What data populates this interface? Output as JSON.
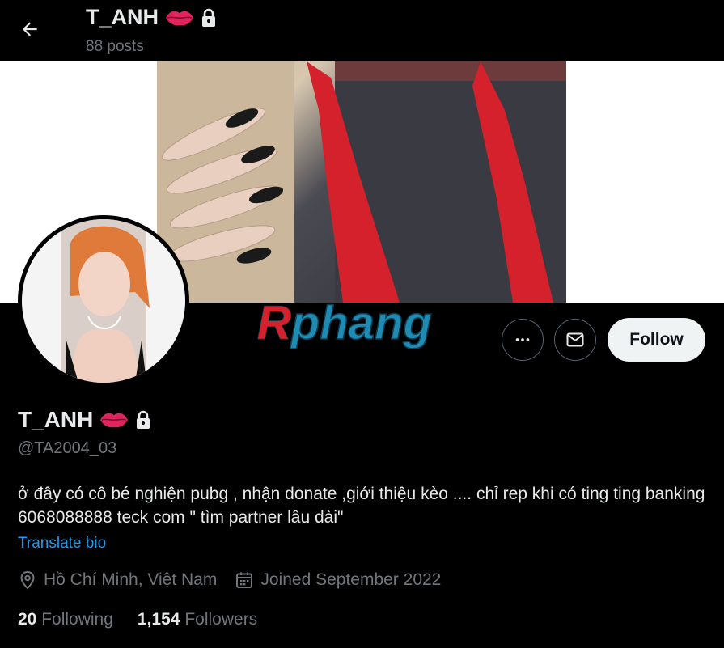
{
  "header": {
    "name": "T_ANH",
    "posts": "88 posts"
  },
  "profile": {
    "name": "T_ANH",
    "handle": "@TA2004_03",
    "bio": "ở đây có cô bé nghiện pubg , nhận donate ,giới thiệu kèo .... chỉ rep khi có ting ting banking 6068088888 teck com \" tìm partner lâu dài\"",
    "translate_label": "Translate bio",
    "location": "Hồ Chí Minh, Việt Nam",
    "joined": "Joined September 2022"
  },
  "stats": {
    "following_count": "20",
    "following_label": "Following",
    "followers_count": "1,154",
    "followers_label": "Followers"
  },
  "actions": {
    "follow_label": "Follow"
  },
  "watermark": {
    "text": "Rphang"
  },
  "icons": {
    "back": "arrow-left-icon",
    "lips": "lips-icon",
    "lock": "lock-icon",
    "more": "more-icon",
    "message": "mail-icon",
    "location": "location-pin-icon",
    "calendar": "calendar-icon"
  },
  "colors": {
    "accent": "#1d9bf0",
    "muted": "#71767b",
    "lips": "#e0245e"
  }
}
